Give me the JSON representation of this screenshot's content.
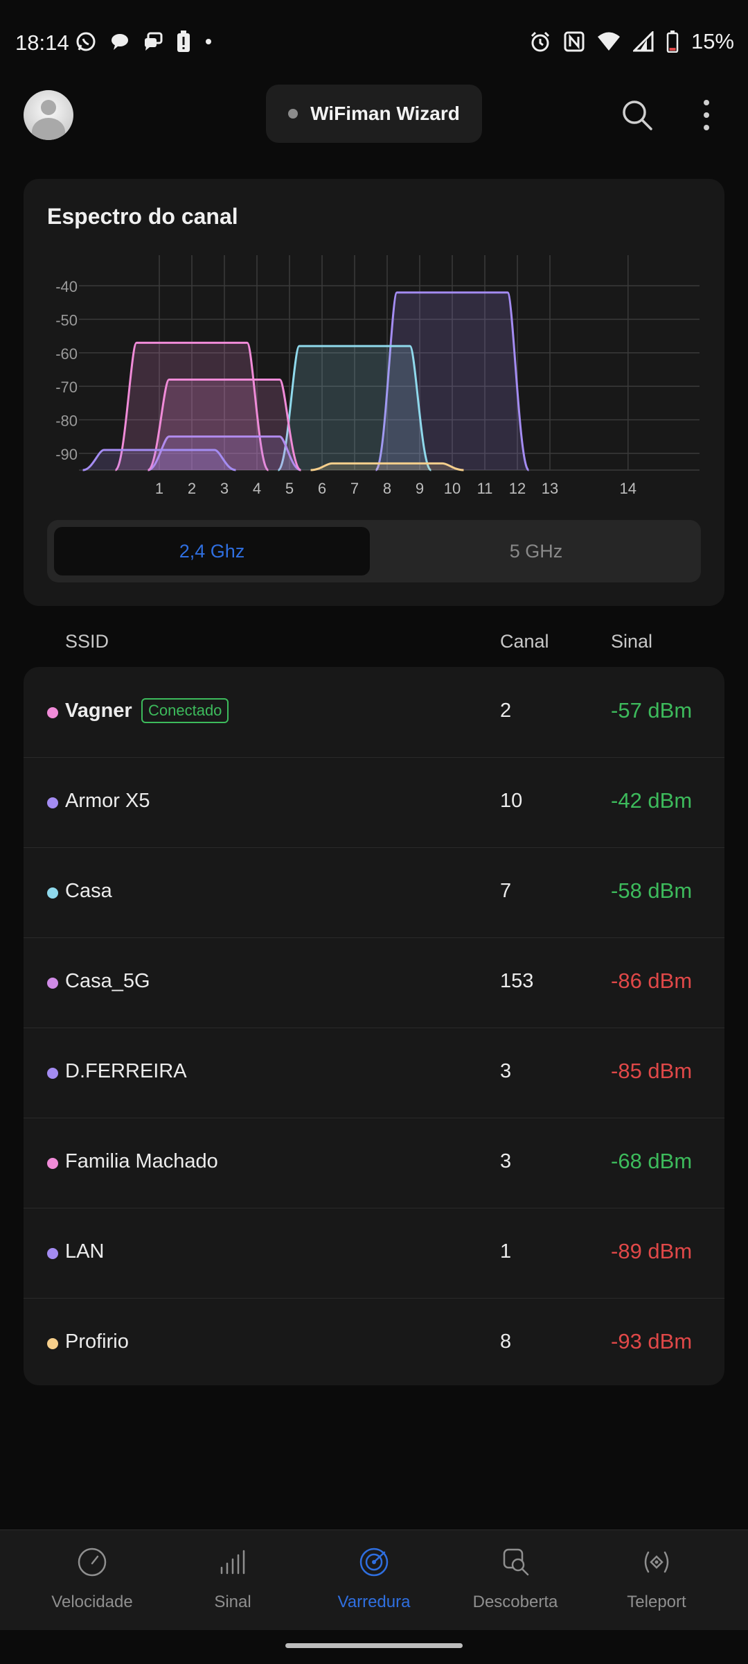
{
  "status_bar": {
    "time": "18:14",
    "battery": "15%",
    "left_icons": [
      "whatsapp-icon",
      "chat-bubble-icon",
      "messages-icon",
      "battery-alert-icon",
      "dot-icon"
    ],
    "right_icons": [
      "alarm-icon",
      "nfc-icon",
      "wifi-icon",
      "cell-signal-icon",
      "battery-icon"
    ]
  },
  "app_bar": {
    "title": "WiFiman Wizard",
    "search_icon": "search-icon",
    "more_icon": "more-vert-icon"
  },
  "spectrum": {
    "title": "Espectro do canal",
    "bands": {
      "active": "2,4 Ghz",
      "inactive": "5 GHz"
    }
  },
  "chart_data": {
    "type": "area",
    "y_ticks": [
      "-40",
      "-50",
      "-60",
      "-70",
      "-80",
      "-90"
    ],
    "x_ticks": [
      "1",
      "2",
      "3",
      "4",
      "5",
      "6",
      "7",
      "8",
      "9",
      "10",
      "11",
      "12",
      "13",
      "14"
    ],
    "ylim": [
      -95,
      -35
    ],
    "grid": true,
    "series": [
      {
        "name": "Vagner",
        "channel": 2,
        "dbm": -57,
        "color": "#f08bd8"
      },
      {
        "name": "Armor X5",
        "channel": 10,
        "dbm": -42,
        "color": "#a48cf2"
      },
      {
        "name": "Casa",
        "channel": 7,
        "dbm": -58,
        "color": "#8fd9ec"
      },
      {
        "name": "D.FERREIRA",
        "channel": 3,
        "dbm": -85,
        "color": "#a48cf2"
      },
      {
        "name": "Familia Machado",
        "channel": 3,
        "dbm": -68,
        "color": "#f08bd8"
      },
      {
        "name": "LAN",
        "channel": 1,
        "dbm": -89,
        "color": "#a48cf2"
      },
      {
        "name": "Profirio",
        "channel": 8,
        "dbm": -93,
        "color": "#f6cf8c"
      }
    ]
  },
  "table": {
    "headers": {
      "ssid": "SSID",
      "canal": "Canal",
      "sinal": "Sinal"
    },
    "connected_label": "Conectado",
    "rows": [
      {
        "ssid": "Vagner",
        "canal": "2",
        "sinal": "-57 dBm",
        "quality": "good",
        "dot": "#f08bd8",
        "connected": true
      },
      {
        "ssid": "Armor X5",
        "canal": "10",
        "sinal": "-42 dBm",
        "quality": "good",
        "dot": "#a48cf2"
      },
      {
        "ssid": "Casa",
        "canal": "7",
        "sinal": "-58 dBm",
        "quality": "good",
        "dot": "#8fd9ec"
      },
      {
        "ssid": "Casa_5G",
        "canal": "153",
        "sinal": "-86 dBm",
        "quality": "bad",
        "dot": "#d08be6"
      },
      {
        "ssid": "D.FERREIRA",
        "canal": "3",
        "sinal": "-85 dBm",
        "quality": "bad",
        "dot": "#a48cf2"
      },
      {
        "ssid": "Familia Machado",
        "canal": "3",
        "sinal": "-68 dBm",
        "quality": "good",
        "dot": "#f08bd8"
      },
      {
        "ssid": "LAN",
        "canal": "1",
        "sinal": "-89 dBm",
        "quality": "bad",
        "dot": "#a48cf2"
      },
      {
        "ssid": "Profirio",
        "canal": "8",
        "sinal": "-93 dBm",
        "quality": "bad",
        "dot": "#f6cf8c"
      }
    ]
  },
  "bottom_nav": [
    {
      "label": "Velocidade",
      "icon": "speedometer-icon"
    },
    {
      "label": "Sinal",
      "icon": "signal-bars-icon"
    },
    {
      "label": "Varredura",
      "icon": "radar-icon",
      "active": true
    },
    {
      "label": "Descoberta",
      "icon": "device-search-icon"
    },
    {
      "label": "Teleport",
      "icon": "teleport-icon"
    }
  ],
  "colors": {
    "accent": "#2f6fe0",
    "good": "#3dbb5c",
    "bad": "#e04848"
  }
}
